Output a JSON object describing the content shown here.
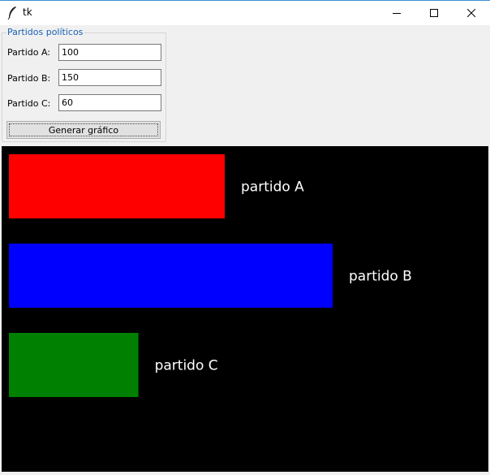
{
  "window": {
    "title": "tk"
  },
  "form": {
    "frame_title": "Partidos políticos",
    "fields": [
      {
        "label": "Partido A:",
        "value": "100"
      },
      {
        "label": "Partido B:",
        "value": "150"
      },
      {
        "label": "Partido C:",
        "value": "60"
      }
    ],
    "button_label": "Generar gráfico"
  },
  "colors": {
    "canvas_background": "#000000",
    "label_color": "#ffffff",
    "frame_title_color": "#1a5fb4"
  },
  "chart_data": {
    "type": "bar",
    "orientation": "horizontal",
    "categories": [
      "partido A",
      "partido B",
      "partido C"
    ],
    "values": [
      100,
      150,
      60
    ],
    "colors": [
      "#ff0000",
      "#0000ff",
      "#008000"
    ],
    "title": "",
    "xlabel": "",
    "ylabel": "",
    "grid": false
  }
}
